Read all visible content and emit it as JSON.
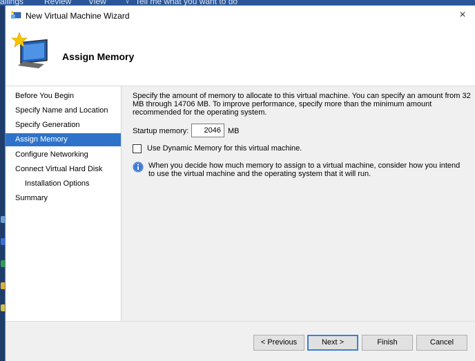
{
  "background": {
    "ribbon_tabs": [
      "ailings",
      "Review",
      "View",
      "Tell me what you want to do"
    ]
  },
  "window": {
    "title": "New Virtual Machine Wizard",
    "close_glyph": "×"
  },
  "header": {
    "heading": "Assign Memory",
    "icon": "wizard-computer-icon"
  },
  "nav": {
    "items": [
      {
        "label": "Before You Begin"
      },
      {
        "label": "Specify Name and Location"
      },
      {
        "label": "Specify Generation"
      },
      {
        "label": "Assign Memory",
        "active": true
      },
      {
        "label": "Configure Networking"
      },
      {
        "label": "Connect Virtual Hard Disk"
      },
      {
        "label": "Installation Options",
        "indent": true
      },
      {
        "label": "Summary"
      }
    ]
  },
  "content": {
    "description": "Specify the amount of memory to allocate to this virtual machine. You can specify an amount from 32 MB through 14706 MB. To improve performance, specify more than the minimum amount recommended for the operating system.",
    "startup_memory_label": "Startup memory:",
    "startup_memory_value": "2046",
    "startup_memory_unit": "MB",
    "dynamic_memory_label": "Use Dynamic Memory for this virtual machine.",
    "dynamic_memory_checked": false,
    "info_text": "When you decide how much memory to assign to a virtual machine, consider how you intend to use the virtual machine and the operating system that it will run."
  },
  "footer": {
    "previous_label": "< Previous",
    "next_label": "Next >",
    "finish_label": "Finish",
    "cancel_label": "Cancel"
  },
  "colors": {
    "accent": "#2e73c9",
    "ribbon": "#2b579a"
  }
}
